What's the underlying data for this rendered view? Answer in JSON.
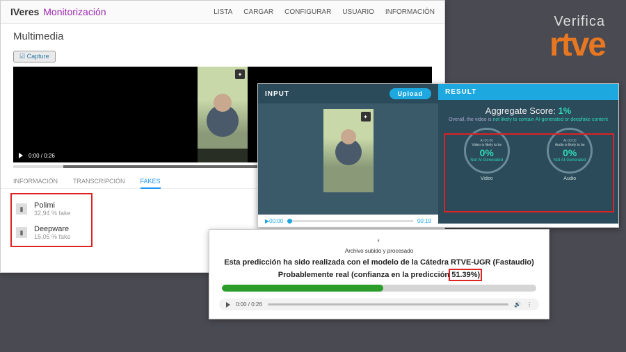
{
  "watermark": {
    "line1": "Verifica",
    "line2": "rtve"
  },
  "mon": {
    "logo": "IVeres",
    "title": "Monitorización",
    "nav": [
      "LISTA",
      "CARGAR",
      "CONFIGURAR",
      "USUARIO",
      "INFORMACIÓN"
    ],
    "section": "Multimedia",
    "option": "☑ Capture",
    "video_time": "0:00 / 0:26",
    "tabs": {
      "info": "INFORMACIÓN",
      "trans": "TRANSCRIPCIÓN",
      "fakes": "FAKES"
    },
    "fakes": [
      {
        "name": "Polimi",
        "pct": "32,94 % fake"
      },
      {
        "name": "Deepware",
        "pct": "15,05 % fake"
      }
    ]
  },
  "df": {
    "input_label": "INPUT",
    "upload": "Upload",
    "audio_start": "00:00",
    "audio_end": "00:19",
    "result_label": "RESULT",
    "agg_label": "Aggregate Score:",
    "agg_value": "1%",
    "agg_sub_pre": "Overall, the video is ",
    "agg_sub_hl": "not likely to contain AI-generated or deepfake content",
    "circles": [
      {
        "at": "At 00:00",
        "lbl": "Video is likely to be",
        "pct": "0%",
        "status": "Not AI-Generated",
        "cap": "Video"
      },
      {
        "at": "At 00:00",
        "lbl": "Audio is likely to be",
        "pct": "0%",
        "status": "Not AI-Generated",
        "cap": "Audio"
      }
    ]
  },
  "pred": {
    "uploaded": "Archivo subido y procesado",
    "line1": "Esta predicción ha sido realizada con el modelo de la Cátedra RTVE-UGR (Fastaudio)",
    "line2_pre": "Probablemente real (confianza en la predicción ",
    "line2_val": "51.39%",
    "line2_post": ")",
    "bar_pct": 51.39,
    "audio_time": "0:00 / 0:26"
  }
}
